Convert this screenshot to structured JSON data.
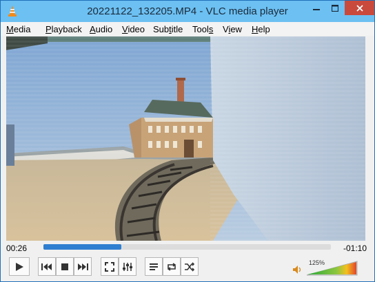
{
  "window": {
    "title": "20221122_132205.MP4 - VLC media player",
    "app_icon": "vlc-cone-icon"
  },
  "menu": [
    {
      "label": "Media",
      "accel": "M",
      "rest": "edia"
    },
    {
      "label": "Playback",
      "accel": "P",
      "rest": "layback"
    },
    {
      "label": "Audio",
      "accel": "A",
      "rest": "udio"
    },
    {
      "label": "Video",
      "accel": "V",
      "rest": "ideo"
    },
    {
      "label": "Subtitle",
      "accel": "t",
      "pre": "Sub",
      "rest": "itle"
    },
    {
      "label": "Tools",
      "accel": "s",
      "pre": "Tool",
      "rest": ""
    },
    {
      "label": "View",
      "accel": "i",
      "pre": "V",
      "rest": "ew"
    },
    {
      "label": "Help",
      "accel": "H",
      "rest": "elp"
    }
  ],
  "player": {
    "elapsed": "00:26",
    "remaining": "-01:10",
    "progress_fraction": 0.27,
    "volume": "125%",
    "volume_fraction": 1.0
  },
  "controls": {
    "icons": [
      "play-icon",
      "previous-icon",
      "stop-icon",
      "next-icon",
      "fullscreen-icon",
      "extended-settings-icon",
      "playlist-icon",
      "loop-icon",
      "shuffle-icon",
      "speaker-icon"
    ]
  },
  "colors": {
    "titlebar": "#6cc0f2",
    "close_button": "#c9493d",
    "seek_fill": "#2f7fd1"
  }
}
